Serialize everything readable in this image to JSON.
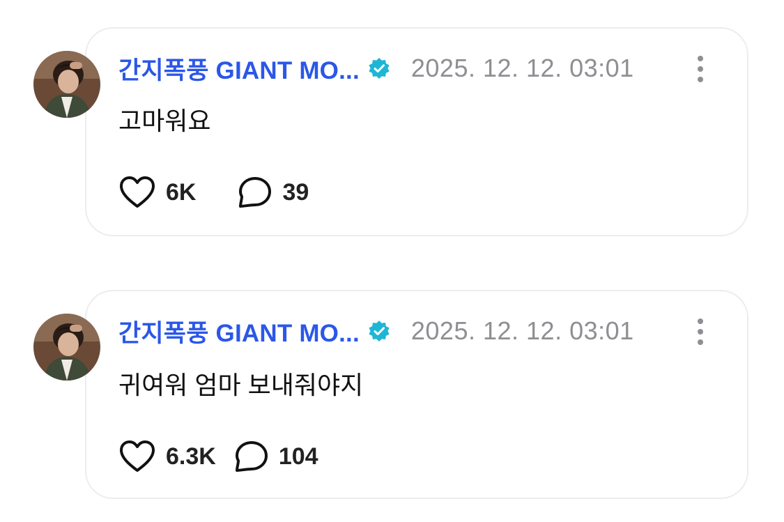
{
  "comments": [
    {
      "username": "간지폭풍 GIANT MO...",
      "timestamp": "2025. 12. 12. 03:01",
      "text": "고마워요",
      "likes": "6K",
      "replies": "39",
      "verified": true
    },
    {
      "username": "간지폭풍 GIANT MO...",
      "timestamp": "2025. 12. 12. 03:01",
      "text": "귀여워 엄마 보내줘야지",
      "likes": "6.3K",
      "replies": "104",
      "verified": true
    }
  ],
  "icons": {
    "like": "heart-icon",
    "reply": "chat-bubble-icon",
    "verified": "verified-badge-icon",
    "more": "more-vertical-icon"
  },
  "colors": {
    "username": "#2b57e8",
    "verified_badge": "#1fb6d6",
    "timestamp": "#8e8e93",
    "card_border": "#ececf1"
  }
}
